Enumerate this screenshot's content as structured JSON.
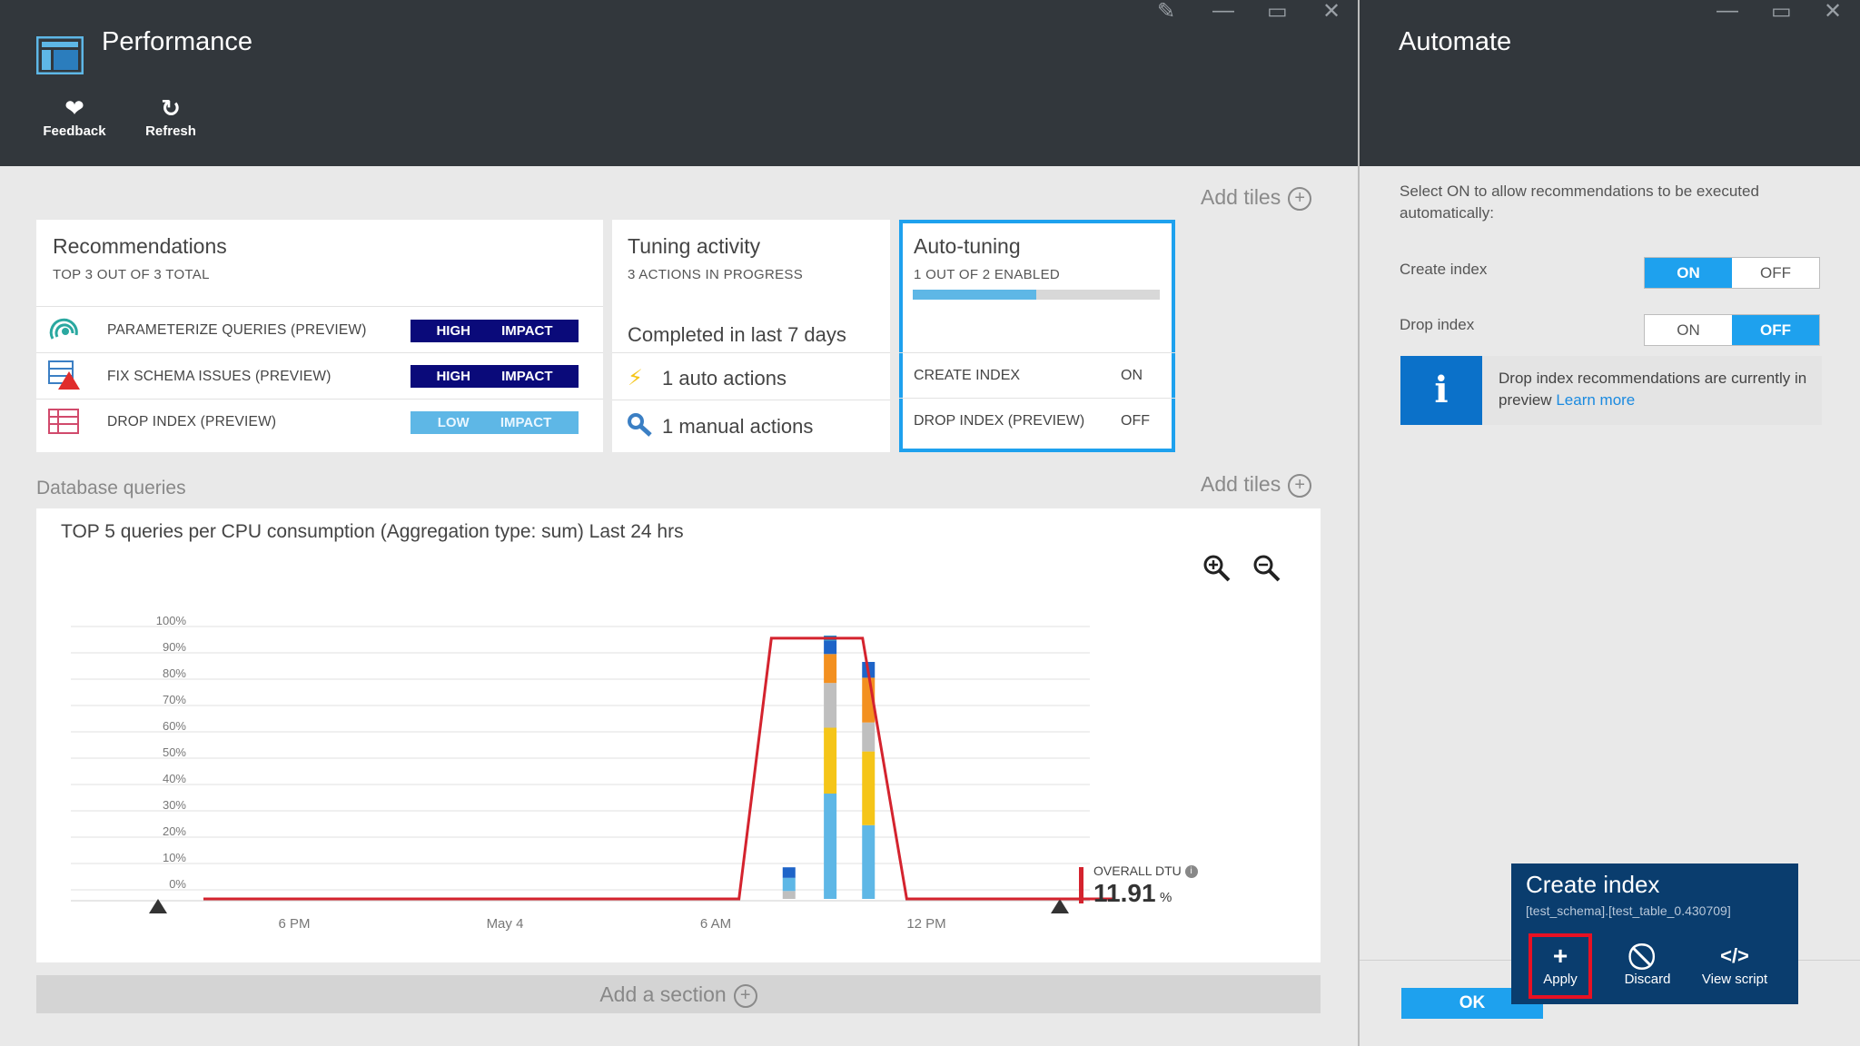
{
  "performance": {
    "title": "Performance",
    "toolbar": {
      "feedback_label": "Feedback",
      "refresh_label": "Refresh"
    },
    "add_tiles_label": "Add tiles",
    "recommendations": {
      "title": "Recommendations",
      "subtitle": "TOP 3 OUT OF 3 TOTAL",
      "items": [
        {
          "label": "PARAMETERIZE QUERIES (PREVIEW)",
          "impact": "HIGH IMPACT"
        },
        {
          "label": "FIX SCHEMA ISSUES (PREVIEW)",
          "impact": "HIGH IMPACT"
        },
        {
          "label": "DROP INDEX (PREVIEW)",
          "impact": "LOW IMPACT"
        }
      ]
    },
    "tuning": {
      "title": "Tuning activity",
      "subtitle": "3 ACTIONS IN PROGRESS",
      "completed": "Completed in last 7 days",
      "auto": "1 auto actions",
      "manual": "1 manual actions"
    },
    "auto_tuning": {
      "title": "Auto-tuning",
      "subtitle": "1 OUT OF 2 ENABLED",
      "progress": 0.5,
      "rows": [
        {
          "label": "CREATE INDEX",
          "value": "ON"
        },
        {
          "label": "DROP INDEX (PREVIEW)",
          "value": "OFF"
        }
      ]
    },
    "db_queries_label": "Database queries",
    "add_section_label": "Add a section"
  },
  "chart_data": {
    "type": "bar",
    "title": "TOP 5 queries per CPU consumption (Aggregation type: sum) Last 24 hrs",
    "y_ticks": [
      "100%",
      "90%",
      "80%",
      "70%",
      "60%",
      "50%",
      "40%",
      "30%",
      "20%",
      "10%",
      "0%"
    ],
    "x_ticks": [
      "6 PM",
      "May 4",
      "6 AM",
      "12 PM"
    ],
    "ylim": [
      0,
      100
    ],
    "xlim": [
      0,
      24
    ],
    "bars": [
      {
        "x": 19.9,
        "segments": [
          {
            "value": 3,
            "color": "#bfbfbf"
          },
          {
            "value": 5,
            "color": "#5eb7e6"
          },
          {
            "value": 4,
            "color": "#1e64c8"
          }
        ]
      },
      {
        "x": 21.3,
        "segments": [
          {
            "value": 40,
            "color": "#5eb7e6"
          },
          {
            "value": 25,
            "color": "#f5c518"
          },
          {
            "value": 17,
            "color": "#bfbfbf"
          },
          {
            "value": 11,
            "color": "#f39020"
          },
          {
            "value": 5,
            "color": "#1e64c8"
          },
          {
            "value": 2,
            "color": "#1e88c8"
          }
        ]
      },
      {
        "x": 22.6,
        "segments": [
          {
            "value": 28,
            "color": "#5eb7e6"
          },
          {
            "value": 28,
            "color": "#f5c518"
          },
          {
            "value": 11,
            "color": "#bfbfbf"
          },
          {
            "value": 17,
            "color": "#f39020"
          },
          {
            "value": 6,
            "color": "#1e64c8"
          }
        ]
      }
    ],
    "overall_line": [
      [
        0,
        0
      ],
      [
        18.2,
        0
      ],
      [
        19.3,
        99
      ],
      [
        22.4,
        99
      ],
      [
        23.9,
        0
      ],
      [
        30.9,
        0
      ]
    ],
    "overall_dtu_label": "OVERALL DTU",
    "overall_dtu_value": "11.91",
    "overall_dtu_unit": "%",
    "colors": {
      "line": "#d4232e"
    }
  },
  "automate": {
    "title": "Automate",
    "description": "Select ON to allow recommendations to be executed automatically:",
    "create_index": {
      "label": "Create index",
      "on": "ON",
      "off": "OFF",
      "state": "on"
    },
    "drop_index": {
      "label": "Drop index",
      "on": "ON",
      "off": "OFF",
      "state": "off"
    },
    "info_text": "Drop index recommendations are currently in preview",
    "info_link": "Learn more",
    "ok_label": "OK"
  },
  "popup": {
    "title": "Create index",
    "subtitle": "[test_schema].[test_table_0.430709]",
    "apply": "Apply",
    "discard": "Discard",
    "view_script": "View script"
  },
  "icons": {
    "app": "performance-dashboard-icon",
    "feedback": "heart-icon",
    "refresh": "refresh-icon",
    "pin": "pin-icon",
    "minimize": "minimize-icon",
    "maximize": "maximize-icon",
    "close": "close-icon",
    "zoom_in": "zoom-in-icon",
    "zoom_out": "zoom-out-icon",
    "info": "info-icon"
  },
  "colors": {
    "accent": "#1ea1ee",
    "header": "#32373c",
    "high_impact": "#0a0a7a",
    "low_impact": "#5eb7e6",
    "popup": "#0a3d6e",
    "highlight": "#e81123"
  }
}
